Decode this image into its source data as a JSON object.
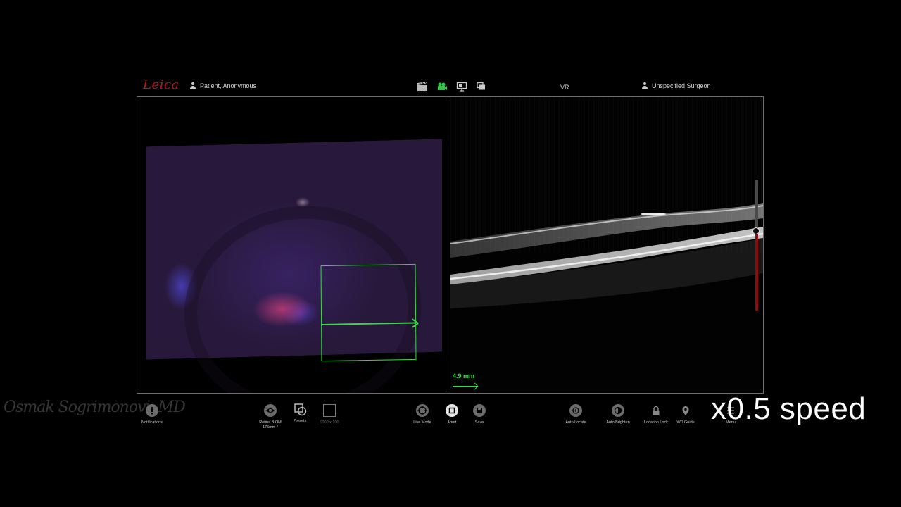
{
  "header": {
    "logo": "Leica",
    "patient": "Patient, Anonymous",
    "mode": "VR",
    "surgeon": "Unspecified Surgeon",
    "mode_icons": [
      "clapperboard-icon",
      "video-camera-icon",
      "monitor-icon",
      "layers-icon"
    ]
  },
  "oct": {
    "scale_label": "4.9 mm",
    "depth_slider_level": 0.61
  },
  "toolbar": {
    "notifications": "Notifications",
    "retina_line1": "Retina BIOM",
    "retina_line2": "175mm *",
    "presets": "Presets",
    "scan_size": "1000 x 100",
    "live_mode": "Live Mode",
    "abort": "Abort",
    "save": "Save",
    "auto_locate": "Auto Locate",
    "auto_brighten": "Auto Brighten",
    "location_lock": "Location Lock",
    "wd_guide": "WD Guide",
    "menu": "Menu"
  },
  "overlay": {
    "signature": "Osmak Sogrimonovi, MD",
    "speed": "x0.5 speed"
  },
  "colors": {
    "accent_green": "#3fd44a",
    "brand_red": "#c4111a",
    "depth_red": "#8a0c0c"
  }
}
